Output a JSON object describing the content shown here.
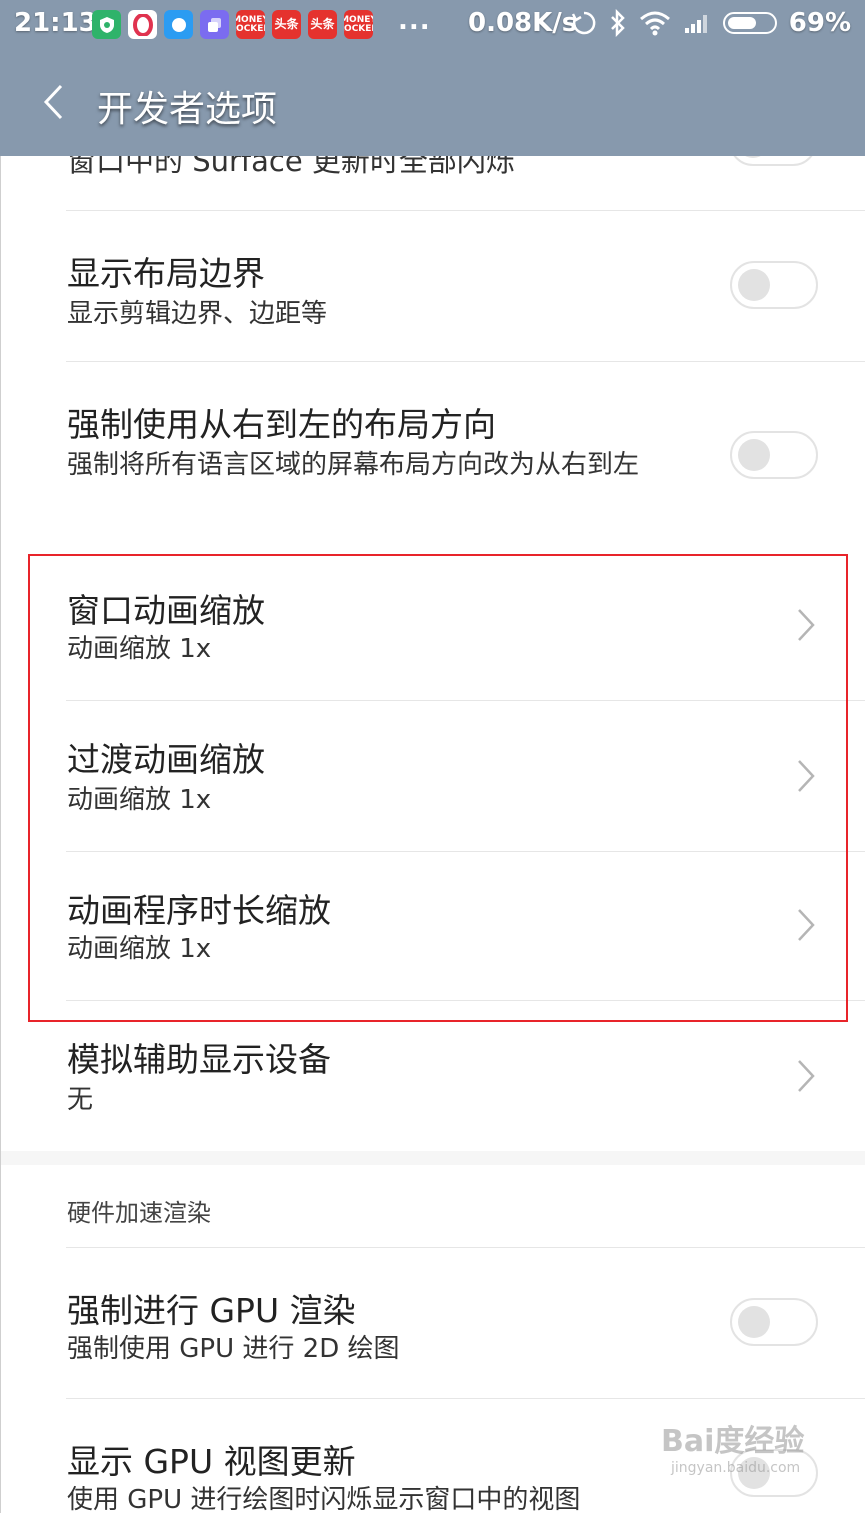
{
  "status_bar": {
    "time": "21:13",
    "apps": [
      {
        "icon": "shield-app-icon",
        "label": "",
        "color": "#2fb36a"
      },
      {
        "icon": "opera-app-icon",
        "label": "",
        "color": "#ffffff"
      },
      {
        "icon": "bubble-app-icon",
        "label": "",
        "color": "#2b9cf2"
      },
      {
        "icon": "stack-app-icon",
        "label": "",
        "color": "#7b6cf0"
      },
      {
        "icon": "money-locker-icon",
        "label": "MONEY LOCKER",
        "color": "#e5322e"
      },
      {
        "icon": "toutiao-icon",
        "label": "头条",
        "color": "#e5322e"
      },
      {
        "icon": "toutiao-icon",
        "label": "头条",
        "color": "#e5322e"
      },
      {
        "icon": "money-locker-icon",
        "label": "MONEY LOCKER",
        "color": "#e5322e"
      }
    ],
    "more": "...",
    "net_speed": "0.08K/s",
    "battery_percent": "69%",
    "battery_level": 0.69
  },
  "header": {
    "back_icon": "chevron-left-icon",
    "title": "开发者选项"
  },
  "list": {
    "partial_subtitle": "窗口中的 Surface 更新时全部闪烁",
    "items": [
      {
        "title": "显示布局边界",
        "subtitle": "显示剪辑边界、边距等",
        "control": "toggle",
        "on": false
      },
      {
        "title": "强制使用从右到左的布局方向",
        "subtitle": "强制将所有语言区域的屏幕布局方向改为从右到左",
        "control": "toggle",
        "on": false
      },
      {
        "title": "窗口动画缩放",
        "subtitle": "动画缩放 1x",
        "control": "chevron"
      },
      {
        "title": "过渡动画缩放",
        "subtitle": "动画缩放 1x",
        "control": "chevron"
      },
      {
        "title": "动画程序时长缩放",
        "subtitle": "动画缩放 1x",
        "control": "chevron"
      },
      {
        "title": "模拟辅助显示设备",
        "subtitle": "无",
        "control": "chevron"
      }
    ],
    "section_header": "硬件加速渲染",
    "hw_items": [
      {
        "title": "强制进行 GPU 渲染",
        "subtitle": "强制使用 GPU 进行 2D 绘图",
        "control": "toggle",
        "on": false
      },
      {
        "title": "显示 GPU 视图更新",
        "subtitle": "使用 GPU 进行绘图时闪烁显示窗口中的视图",
        "control": "toggle",
        "on": false
      }
    ]
  },
  "highlight_color": "#e8242a",
  "watermark": {
    "text": "Bai度经验",
    "url_text": "jingyan.baidu.com"
  }
}
